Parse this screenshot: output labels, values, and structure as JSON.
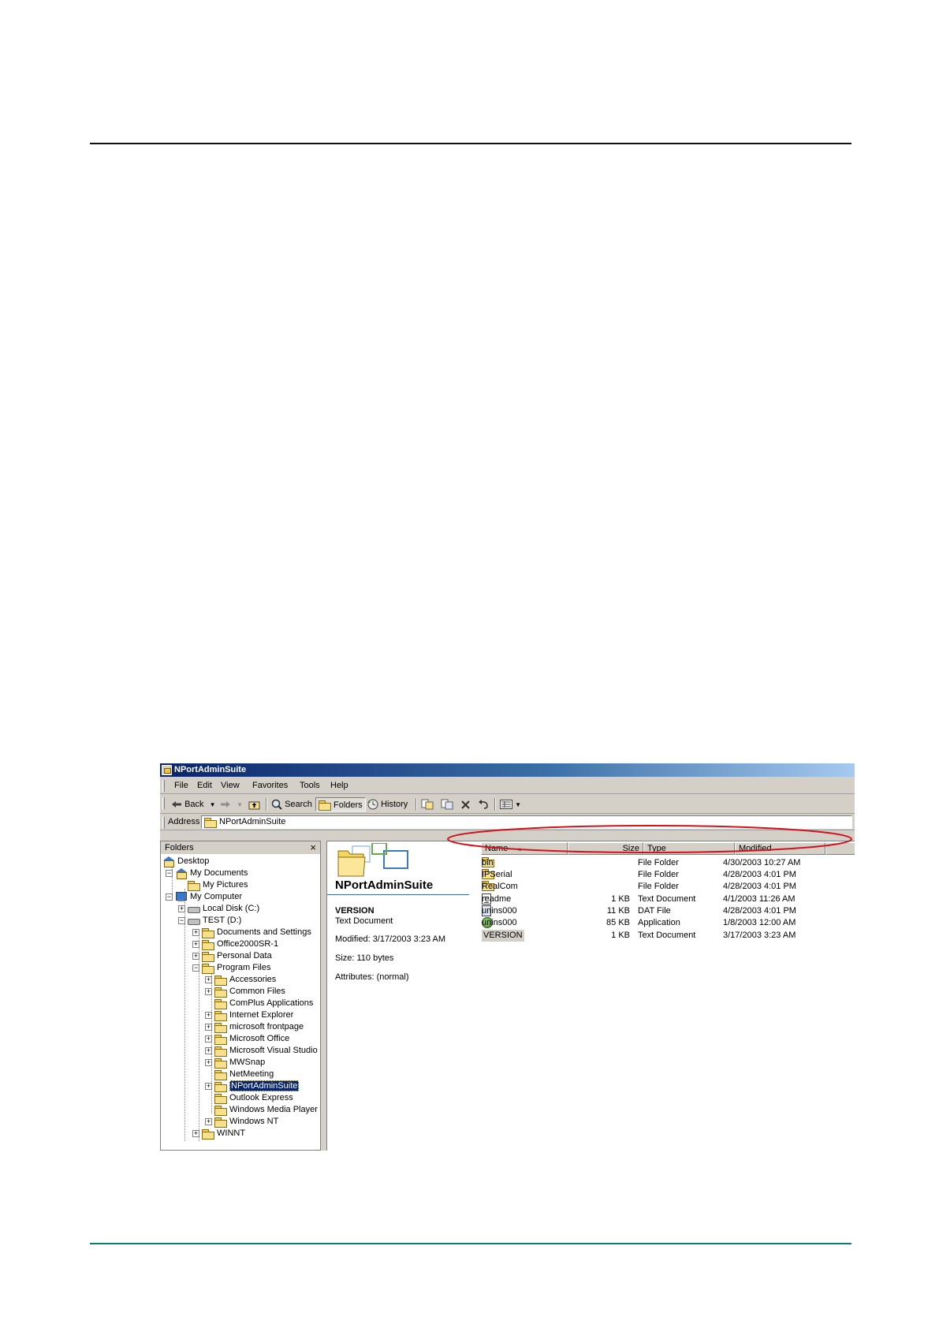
{
  "window": {
    "title": "NPortAdminSuite",
    "menu": [
      "File",
      "Edit",
      "View",
      "Favorites",
      "Tools",
      "Help"
    ],
    "toolbar": {
      "back": "Back",
      "search": "Search",
      "folders": "Folders",
      "history": "History"
    },
    "address": {
      "label": "Address",
      "value": "NPortAdminSuite"
    }
  },
  "folders_pane": {
    "title": "Folders",
    "close": "×",
    "tree": [
      {
        "label": "Desktop",
        "icon": "desktop-icon"
      },
      {
        "label": "My Documents",
        "icon": "folder-icon"
      },
      {
        "label": "My Pictures",
        "icon": "folder-icon"
      },
      {
        "label": "My Computer",
        "icon": "computer-icon"
      },
      {
        "label": "Local Disk (C:)",
        "icon": "drive-icon"
      },
      {
        "label": "TEST (D:)",
        "icon": "drive-icon"
      },
      {
        "label": "Documents and Settings",
        "icon": "folder-icon"
      },
      {
        "label": "Office2000SR-1",
        "icon": "folder-icon"
      },
      {
        "label": "Personal Data",
        "icon": "folder-icon"
      },
      {
        "label": "Program Files",
        "icon": "folder-icon"
      },
      {
        "label": "Accessories",
        "icon": "folder-icon"
      },
      {
        "label": "Common Files",
        "icon": "folder-icon"
      },
      {
        "label": "ComPlus Applications",
        "icon": "folder-icon"
      },
      {
        "label": "Internet Explorer",
        "icon": "folder-icon"
      },
      {
        "label": "microsoft frontpage",
        "icon": "folder-icon"
      },
      {
        "label": "Microsoft Office",
        "icon": "folder-icon"
      },
      {
        "label": "Microsoft Visual Studio",
        "icon": "folder-icon"
      },
      {
        "label": "MWSnap",
        "icon": "folder-icon"
      },
      {
        "label": "NetMeeting",
        "icon": "folder-icon"
      },
      {
        "label": "NPortAdminSuite",
        "icon": "folder-icon",
        "selected": true
      },
      {
        "label": "Outlook Express",
        "icon": "folder-icon"
      },
      {
        "label": "Windows Media Player",
        "icon": "folder-icon"
      },
      {
        "label": "Windows NT",
        "icon": "folder-icon"
      },
      {
        "label": "WINNT",
        "icon": "folder-icon"
      }
    ]
  },
  "webview": {
    "title": "NPortAdminSuite",
    "selected_name": "VERSION",
    "selected_type": "Text Document",
    "modified": "Modified: 3/17/2003 3:23 AM",
    "size": "Size: 110 bytes",
    "attributes": "Attributes: (normal)"
  },
  "file_list": {
    "columns": [
      "Name",
      "Size",
      "Type",
      "Modified"
    ],
    "rows": [
      {
        "name": "bin",
        "size": "",
        "type": "File Folder",
        "modified": "4/30/2003 10:27 AM",
        "icon": "folder-icon"
      },
      {
        "name": "IPSerial",
        "size": "",
        "type": "File Folder",
        "modified": "4/28/2003 4:01 PM",
        "icon": "folder-icon",
        "highlighted": true
      },
      {
        "name": "RealCom",
        "size": "",
        "type": "File Folder",
        "modified": "4/28/2003 4:01 PM",
        "icon": "folder-icon"
      },
      {
        "name": "readme",
        "size": "1 KB",
        "type": "Text Document",
        "modified": "4/1/2003 11:26 AM",
        "icon": "text-document-icon"
      },
      {
        "name": "unins000",
        "size": "11 KB",
        "type": "DAT File",
        "modified": "4/28/2003 4:01 PM",
        "icon": "dat-file-icon"
      },
      {
        "name": "unins000",
        "size": "85 KB",
        "type": "Application",
        "modified": "1/8/2003 12:00 AM",
        "icon": "application-icon"
      },
      {
        "name": "VERSION",
        "size": "1 KB",
        "type": "Text Document",
        "modified": "3/17/2003 3:23 AM",
        "icon": "text-document-icon",
        "selected": true
      }
    ]
  },
  "colors": {
    "title_gradient_start": "#0a246a",
    "title_gradient_end": "#a6caf0",
    "annotation": "#d0141c",
    "footer_rule": "#0b7b74"
  }
}
